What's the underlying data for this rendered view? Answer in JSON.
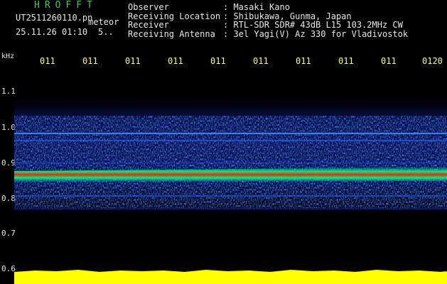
{
  "header": {
    "brand": "HROFFT",
    "filename": "UT2511260110.pn",
    "meteor_label": "meteor",
    "datetime": "25.11.26 01:10",
    "count": "5.."
  },
  "info": {
    "observer_key": "Observer",
    "observer_val": ": Masaki Kano",
    "location_key": "Receiving Location",
    "location_val": ": Shibukawa, Gunma, Japan",
    "receiver_key": "Receiver",
    "receiver_val": ": RTL-SDR SDR# 43dB L15 103.2MHz CW",
    "antenna_key": "Receiving Antenna",
    "antenna_val": ": 3el Yagi(V) Az 330 for Vladivostok"
  },
  "axis": {
    "unit": "kHz",
    "y_ticks": [
      "1.1",
      "1.0",
      "0.9",
      "0.8",
      "0.7",
      "0.6"
    ],
    "time_ticks": [
      "011",
      "011",
      "011",
      "011",
      "011",
      "011",
      "011",
      "011",
      "011",
      "0120"
    ]
  },
  "colors": {
    "background": "#000000",
    "brand": "#2fd06a",
    "time_labels": "#ffff66",
    "signal": "#ff2020",
    "noise": "#1a3cff",
    "level": "#ffff00"
  }
}
